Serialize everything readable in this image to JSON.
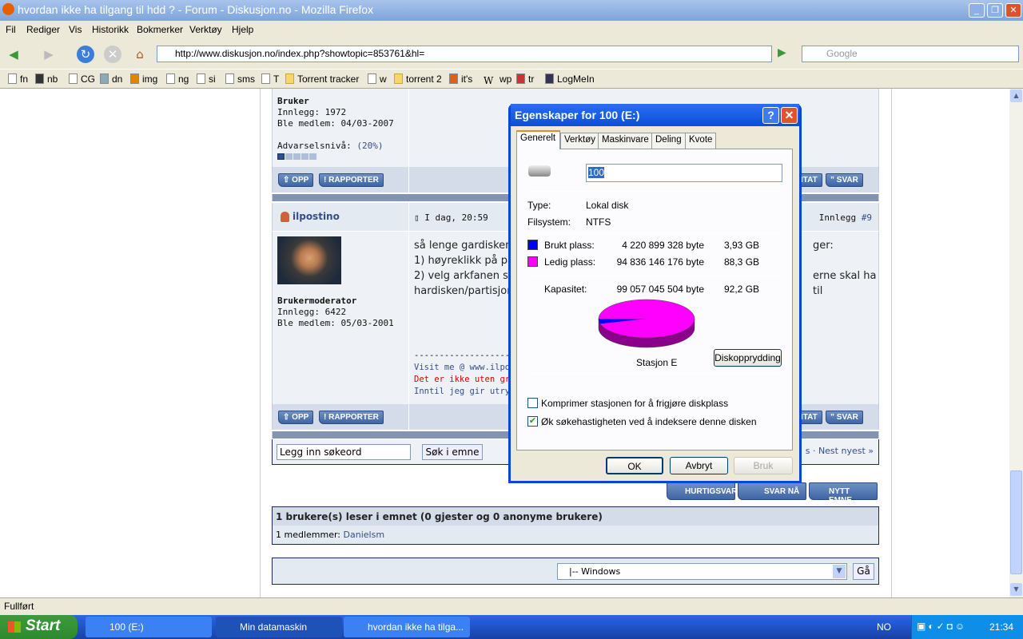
{
  "window": {
    "title": "hvordan ikke ha tilgang til hdd ? - Forum - Diskusjon.no - Mozilla Firefox"
  },
  "menu": [
    "Fil",
    "Rediger",
    "Vis",
    "Historikk",
    "Bokmerker",
    "Verktøy",
    "Hjelp"
  ],
  "nav": {
    "url": "http://www.diskusjon.no/index.php?showtopic=853761&hl=",
    "search_placeholder": "Google"
  },
  "bookmarks": [
    "fn",
    "nb",
    "CG",
    "dn",
    "img",
    "ng",
    "si",
    "sms",
    "T",
    "Torrent tracker",
    "w",
    "torrent 2",
    "it's",
    "wp",
    "tr",
    "LogMeIn"
  ],
  "forum": {
    "post1": {
      "group": "Bruker",
      "posts": "Innlegg: 1972",
      "joined": "Ble medlem: 04/03-2007",
      "warn_label": "Advarselsnivå:",
      "warn_value": "(20%)",
      "warn_level": 0.2
    },
    "buttons": {
      "up": "OPP",
      "report": "RAPPORTER",
      "quote": "ITAT",
      "reply": "SVAR"
    },
    "post2": {
      "author": "ilpostino",
      "date": "I dag, 20:59",
      "number_label": "Innlegg",
      "number": "#9",
      "group": "Brukermoderator",
      "posts": "Innlegg: 6422",
      "joined": "Ble medlem: 05/03-2001",
      "body": [
        "så lenge gardisken",
        "1) høyreklikk på pa",
        "2) velg arkfanen se",
        "hardisken/partisjon"
      ],
      "body_right": [
        "ger:",
        "erne skal ha til"
      ],
      "sig_sep": "--------------------",
      "sig": [
        "Visit me @ www.ilpost",
        "Det er ikke uten grun",
        "Inntil jeg gir utrykk fo"
      ]
    },
    "search_value": "Legg inn søkeord",
    "search_button": "Søk i emne",
    "pagination": "s · Nest nyest »",
    "actions": [
      "HURTIGSVAR",
      "SVAR NÅ",
      "NYTT EMNE"
    ],
    "readers": "1 brukere(s) leser i emnet (0 gjester og 0 anonyme brukere)",
    "members_label": "1 medlemmer:",
    "member": "Danielsm",
    "jump_value": "|-- Windows",
    "go": "Gå"
  },
  "dialog": {
    "title": "Egenskaper for 100 (E:)",
    "tabs": [
      "Generelt",
      "Verktøy",
      "Maskinvare",
      "Deling",
      "Kvote"
    ],
    "name": "100",
    "type_label": "Type:",
    "type": "Lokal disk",
    "fs_label": "Filsystem:",
    "fs": "NTFS",
    "used_label": "Brukt plass:",
    "used_bytes": "4 220 899 328 byte",
    "used_gb": "3,93 GB",
    "free_label": "Ledig plass:",
    "free_bytes": "94 836 146 176 byte",
    "free_gb": "88,3 GB",
    "cap_label": "Kapasitet:",
    "cap_bytes": "99 057 045 504 byte",
    "cap_gb": "92,2 GB",
    "used_color": "#0000ff",
    "free_color": "#ff00ff",
    "used_fraction": 0.0426,
    "drive_label": "Stasjon E",
    "cleanup": "Diskopprydding",
    "compress": "Komprimer stasjonen for å frigjøre diskplass",
    "compress_checked": false,
    "index": "Øk søkehastigheten ved å indeksere denne disken",
    "index_checked": true,
    "ok": "OK",
    "cancel": "Avbryt",
    "apply": "Bruk"
  },
  "status": "Fullført",
  "taskbar": {
    "start": "Start",
    "tasks": [
      "100 (E:)",
      "Min datamaskin",
      "hvordan ikke ha tilga..."
    ],
    "lang": "NO",
    "clock": "21:34"
  }
}
